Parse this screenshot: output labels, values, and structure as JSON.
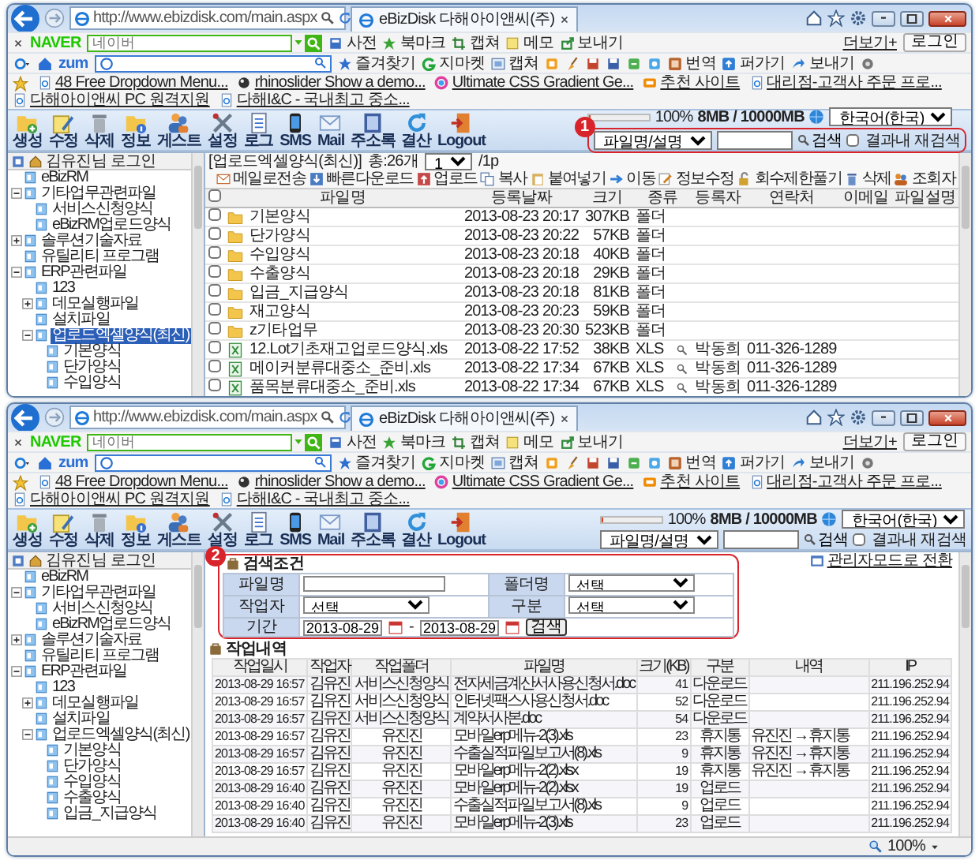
{
  "windows": [
    {
      "browser": {
        "address": "http://www.ebizdisk.com/main.aspx",
        "tab_title": "eBizDisk 다해아이앤씨(주)",
        "naver": {
          "logo": "NAVER",
          "placeholder": "네이버",
          "items": [
            "사전",
            "북마크",
            "캡쳐",
            "메모",
            "보내기"
          ],
          "more": "더보기+",
          "login": "로그인"
        },
        "zum": {
          "logo": "zum",
          "items": [
            "즐겨찾기",
            "지마켓",
            "캡쳐",
            "번역",
            "퍼가기",
            "보내기"
          ]
        },
        "favorites": [
          "48 Free Dropdown Menu...",
          "rhinoslider Show a demo...",
          "Ultimate CSS Gradient Ge...",
          "추천 사이트",
          "대리점-고객사 주문 프로...",
          "다해아이앤씨 PC 원격지원",
          "다해I&C - 국내최고 중소..."
        ]
      },
      "app": {
        "toolbar": [
          "생성",
          "수정",
          "삭제",
          "정보",
          "게스트",
          "설정",
          "로그",
          "SMS",
          "Mail",
          "주소록",
          "결산",
          "Logout"
        ],
        "storage": {
          "level": 0.02,
          "percent": "100%",
          "usage": "8MB / 10000MB"
        },
        "language": "한국어(한국)",
        "search": {
          "field": "파일명/설명",
          "button": "검색",
          "refine": {
            "label": "결과내 재검색",
            "checked": false
          },
          "callout": "1"
        }
      },
      "sidebar": {
        "header": "김유진님 로그인",
        "tree": [
          {
            "label": "eBizRM",
            "selected": false
          },
          {
            "label": "기타업무관련파일",
            "selected": false,
            "expanded": true,
            "children": [
              {
                "label": "서비스신청양식",
                "selected": false
              },
              {
                "label": "eBizRM업로드양식",
                "selected": false
              }
            ]
          },
          {
            "label": "솔루션기술자료",
            "selected": false,
            "expanded": false
          },
          {
            "label": "유틸리티 프로그램",
            "selected": false
          },
          {
            "label": "ERP관련파일",
            "selected": false,
            "expanded": true,
            "children": [
              {
                "label": "123",
                "selected": false
              },
              {
                "label": "데모실행파일",
                "selected": false,
                "expanded": false
              },
              {
                "label": "설치파일",
                "selected": false
              },
              {
                "label": "업로드엑셀양식(최신)",
                "selected": true,
                "expanded": true,
                "children": [
                  {
                    "label": "기본양식",
                    "selected": false
                  },
                  {
                    "label": "단가양식",
                    "selected": false
                  },
                  {
                    "label": "수입양식",
                    "selected": false
                  }
                ]
              }
            ]
          }
        ]
      },
      "view": {
        "kind": "files",
        "path": "[업로드엑셀양식(최신)]",
        "count": "총:26개",
        "page": "1",
        "pages": "/1p",
        "actions": [
          "메일로전송",
          "빠른다운로드",
          "업로드",
          "복사",
          "붙여넣기",
          "이동",
          "정보수정",
          "회수제한풀기",
          "삭제",
          "조회자"
        ],
        "all_checked": false,
        "columns": [
          "파일명",
          "등록날짜",
          "크기",
          "종류",
          "등록자",
          "연락처",
          "이메일",
          "파일설명"
        ],
        "rows": [
          {
            "kind": "folder",
            "checked": false,
            "name": "기본양식",
            "date": "2013-08-23 20:17",
            "size": "307KB",
            "type": "폴더"
          },
          {
            "kind": "folder",
            "checked": false,
            "name": "단가양식",
            "date": "2013-08-23 20:22",
            "size": "57KB",
            "type": "폴더"
          },
          {
            "kind": "folder",
            "checked": false,
            "name": "수입양식",
            "date": "2013-08-23 20:18",
            "size": "40KB",
            "type": "폴더"
          },
          {
            "kind": "folder",
            "checked": false,
            "name": "수출양식",
            "date": "2013-08-23 20:18",
            "size": "29KB",
            "type": "폴더"
          },
          {
            "kind": "folder",
            "checked": false,
            "name": "입금_지급양식",
            "date": "2013-08-23 20:18",
            "size": "81KB",
            "type": "폴더"
          },
          {
            "kind": "folder",
            "checked": false,
            "name": "재고양식",
            "date": "2013-08-23 20:23",
            "size": "59KB",
            "type": "폴더"
          },
          {
            "kind": "folder",
            "checked": false,
            "name": "z기타업무",
            "date": "2013-08-23 20:30",
            "size": "523KB",
            "type": "폴더"
          },
          {
            "kind": "excel",
            "checked": false,
            "name": "12.Lot기초재고업로드양식.xls",
            "date": "2013-08-22 17:52",
            "size": "38KB",
            "type": "XLS",
            "owner": "박동희",
            "phone": "011-326-1289"
          },
          {
            "kind": "excel",
            "checked": false,
            "name": "메이커분류대중소_준비.xls",
            "date": "2013-08-22 17:34",
            "size": "67KB",
            "type": "XLS",
            "owner": "박동희",
            "phone": "011-326-1289"
          },
          {
            "kind": "excel",
            "checked": false,
            "name": "품목분류대중소_준비.xls",
            "date": "2013-08-22 17:34",
            "size": "67KB",
            "type": "XLS",
            "owner": "박동희",
            "phone": "011-326-1289"
          }
        ]
      }
    },
    {
      "browser": {
        "address": "http://www.ebizdisk.com/main.aspx",
        "tab_title": "eBizDisk 다해아이앤씨(주)",
        "naver": {
          "logo": "NAVER",
          "placeholder": "네이버",
          "items": [
            "사전",
            "북마크",
            "캡쳐",
            "메모",
            "보내기"
          ],
          "more": "더보기+",
          "login": "로그인"
        },
        "zum": {
          "logo": "zum",
          "items": [
            "즐겨찾기",
            "지마켓",
            "캡쳐",
            "번역",
            "퍼가기",
            "보내기"
          ]
        },
        "favorites": [
          "48 Free Dropdown Menu...",
          "rhinoslider Show a demo...",
          "Ultimate CSS Gradient Ge...",
          "추천 사이트",
          "대리점-고객사 주문 프로...",
          "다해아이앤씨 PC 원격지원",
          "다해I&C - 국내최고 중소..."
        ]
      },
      "app": {
        "toolbar": [
          "생성",
          "수정",
          "삭제",
          "정보",
          "게스트",
          "설정",
          "로그",
          "SMS",
          "Mail",
          "주소록",
          "결산",
          "Logout"
        ],
        "storage": {
          "level": 0.02,
          "percent": "100%",
          "usage": "8MB / 10000MB"
        },
        "language": "한국어(한국)",
        "search": {
          "field": "파일명/설명",
          "button": "검색",
          "refine": {
            "label": "결과내 재검색",
            "checked": false
          }
        }
      },
      "sidebar": {
        "header": "김유진님 로그인",
        "tree": [
          {
            "label": "eBizRM",
            "selected": false
          },
          {
            "label": "기타업무관련파일",
            "selected": false,
            "expanded": true,
            "children": [
              {
                "label": "서비스신청양식",
                "selected": false
              },
              {
                "label": "eBizRM업로드양식",
                "selected": false
              }
            ]
          },
          {
            "label": "솔루션기술자료",
            "selected": false,
            "expanded": false
          },
          {
            "label": "유틸리티 프로그램",
            "selected": false
          },
          {
            "label": "ERP관련파일",
            "selected": false,
            "expanded": true,
            "children": [
              {
                "label": "123",
                "selected": false
              },
              {
                "label": "데모실행파일",
                "selected": false,
                "expanded": false
              },
              {
                "label": "설치파일",
                "selected": false
              },
              {
                "label": "업로드엑셀양식(최신)",
                "selected": false,
                "expanded": true,
                "children": [
                  {
                    "label": "기본양식",
                    "selected": false
                  },
                  {
                    "label": "단가양식",
                    "selected": false
                  },
                  {
                    "label": "수입양식",
                    "selected": false
                  },
                  {
                    "label": "수출양식",
                    "selected": false
                  },
                  {
                    "label": "입금_지급양식",
                    "selected": false
                  }
                ]
              }
            ]
          }
        ]
      },
      "view": {
        "kind": "log",
        "callout": "2",
        "title": "검색조건",
        "admin_link": "관리자모드로 전환",
        "form": {
          "file_label": "파일명",
          "folder_label": "폴더명",
          "folder_value": "선택",
          "worker_label": "작업자",
          "worker_value": "선택",
          "type_label": "구분",
          "type_value": "선택",
          "period_label": "기간",
          "date_from": "2013-08-29",
          "date_sep": "-",
          "date_to": "2013-08-29",
          "search": "검색"
        },
        "history_title": "작업내역",
        "columns": [
          "작업일시",
          "작업자",
          "작업폴더",
          "파일명",
          "크기(KB)",
          "구분",
          "내역",
          "IP"
        ],
        "rows": [
          {
            "time": "2013-08-29 16:57",
            "worker": "김유진",
            "folder": "서비스신청양식",
            "file": "전자세금계산서사용신청서.doc",
            "size": "41",
            "action": "다운로드",
            "ip": "211.196.252.94"
          },
          {
            "time": "2013-08-29 16:57",
            "worker": "김유진",
            "folder": "서비스신청양식",
            "file": "인터넷팩스사용신청서.doc",
            "size": "52",
            "action": "다운로드",
            "ip": "211.196.252.94"
          },
          {
            "time": "2013-08-29 16:57",
            "worker": "김유진",
            "folder": "서비스신청양식",
            "file": "계약서사본.doc",
            "size": "54",
            "action": "다운로드",
            "ip": "211.196.252.94"
          },
          {
            "time": "2013-08-29 16:57",
            "worker": "김유진",
            "folder": "유진진",
            "file": "모바일erp메뉴-2(3).xls",
            "size": "23",
            "action": "휴지통",
            "detail": "유진진 → 휴지통",
            "ip": "211.196.252.94"
          },
          {
            "time": "2013-08-29 16:57",
            "worker": "김유진",
            "folder": "유진진",
            "file": "수출실적파일보고서(8).xls",
            "size": "9",
            "action": "휴지통",
            "detail": "유진진 → 휴지통",
            "ip": "211.196.252.94"
          },
          {
            "time": "2013-08-29 16:57",
            "worker": "김유진",
            "folder": "유진진",
            "file": "모바일erp메뉴-2(2).xlsx",
            "size": "19",
            "action": "휴지통",
            "detail": "유진진 → 휴지통",
            "ip": "211.196.252.94"
          },
          {
            "time": "2013-08-29 16:40",
            "worker": "김유진",
            "folder": "유진진",
            "file": "모바일erp메뉴-2(2).xlsx",
            "size": "19",
            "action": "업로드",
            "ip": "211.196.252.94"
          },
          {
            "time": "2013-08-29 16:40",
            "worker": "김유진",
            "folder": "유진진",
            "file": "수출실적파일보고서(8).xls",
            "size": "9",
            "action": "업로드",
            "ip": "211.196.252.94"
          },
          {
            "time": "2013-08-29 16:40",
            "worker": "김유진",
            "folder": "유진진",
            "file": "모바일erp메뉴-2(3).xls",
            "size": "23",
            "action": "업로드",
            "ip": "211.196.252.94"
          }
        ]
      },
      "status_bar": {
        "zoom": "100%"
      }
    }
  ]
}
